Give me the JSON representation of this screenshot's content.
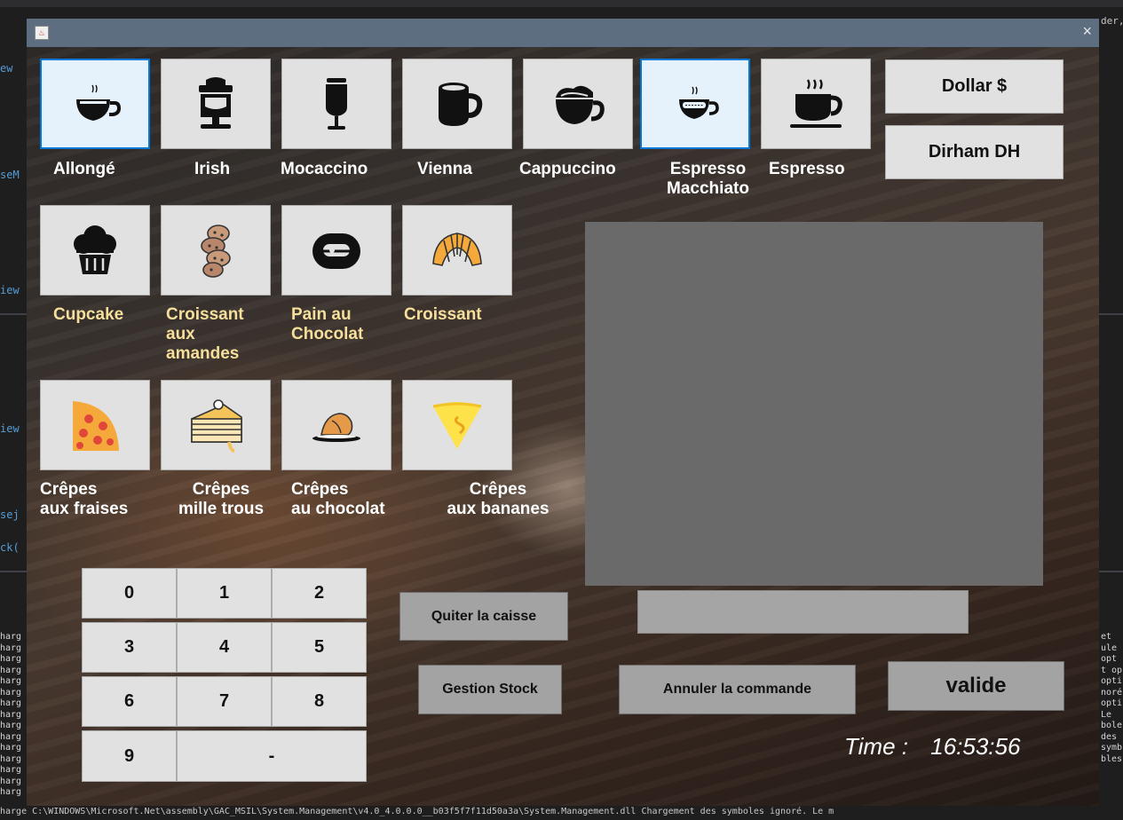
{
  "ide": {
    "left_fragments": [
      "ew",
      "seM",
      "iew",
      "iew",
      "sej",
      "ck("
    ],
    "right_header": "der, M",
    "right_log": [
      "et",
      "ule",
      "opt",
      "t op",
      "opti",
      "noré",
      "opti",
      "Le",
      "bole",
      "des",
      "symb",
      "bles"
    ],
    "left_log_prefix": "harg",
    "bottom_line": "harge  C:\\WINDOWS\\Microsoft.Net\\assembly\\GAC_MSIL\\System.Management\\v4.0_4.0.0.0__b03f5f7f11d50a3a\\System.Management.dll  Chargement des symboles ignoré. Le m"
  },
  "window": {
    "close_symbol": "×"
  },
  "drinks": [
    {
      "label": "Allongé",
      "icon": "cup-steam-icon",
      "selected": true
    },
    {
      "label": "Irish",
      "icon": "irish-coffee-machine-icon",
      "selected": false
    },
    {
      "label": "Mocaccino",
      "icon": "tall-glass-icon",
      "selected": false
    },
    {
      "label": "Vienna",
      "icon": "mug-icon",
      "selected": false
    },
    {
      "label": "Cappuccino",
      "icon": "cappuccino-cup-icon",
      "selected": false
    },
    {
      "label": "Espresso\nMacchiato",
      "icon": "macchiato-cup-icon",
      "selected": true
    },
    {
      "label": "Espresso",
      "icon": "espresso-cup-icon",
      "selected": false
    }
  ],
  "pastries": [
    {
      "label": "Cupcake",
      "icon": "cupcake-icon"
    },
    {
      "label": "Croissant\naux\namandes",
      "icon": "almond-croissant-icon"
    },
    {
      "label": "Pain au\nChocolat",
      "icon": "donut-icon"
    },
    {
      "label": "Croissant",
      "icon": "croissant-icon"
    }
  ],
  "crepes": [
    {
      "label": "Crêpes\naux fraises",
      "icon": "strawberry-crepe-icon"
    },
    {
      "label": "Crêpes\nmille trous",
      "icon": "cake-slice-icon"
    },
    {
      "label": "Crêpes\nau chocolat",
      "icon": "chocolate-crepe-icon"
    },
    {
      "label": "Crêpes\naux bananes",
      "icon": "banana-crepe-icon"
    }
  ],
  "currency": {
    "dollar": "Dollar $",
    "dirham": "Dirham DH"
  },
  "keypad": [
    "0",
    "1",
    "2",
    "3",
    "4",
    "5",
    "6",
    "7",
    "8",
    "9",
    "-"
  ],
  "actions": {
    "quit": "Quiter la caisse",
    "stock": "Gestion Stock",
    "cancel": "Annuler la commande",
    "validate": "valide"
  },
  "status": {
    "time_label": "Time :",
    "time_value": "16:53:56"
  }
}
